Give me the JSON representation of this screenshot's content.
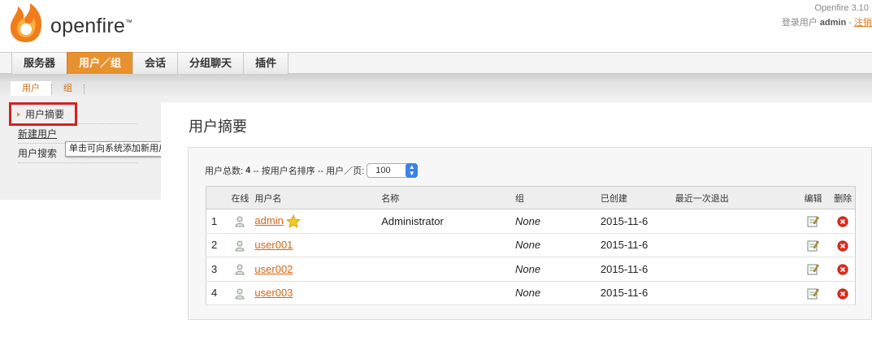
{
  "header": {
    "logo_text": "openfire",
    "logo_tm": "™",
    "version": "Openfire 3.10",
    "login_prefix": "登录用户",
    "login_user": "admin",
    "login_sep": "-",
    "logout_label": "注销"
  },
  "main_tabs": [
    {
      "label": "服务器",
      "active": false
    },
    {
      "label": "用户／组",
      "active": true
    },
    {
      "label": "会话",
      "active": false
    },
    {
      "label": "分组聊天",
      "active": false
    },
    {
      "label": "插件",
      "active": false
    }
  ],
  "sub_tabs": [
    {
      "label": "用户",
      "active": true
    },
    {
      "label": "组",
      "active": false
    }
  ],
  "sidebar": {
    "items": [
      {
        "label": "用户摘要",
        "current": true
      },
      {
        "label": "新建用户",
        "current": false
      },
      {
        "label": "用户搜索",
        "current": false
      }
    ],
    "tooltip": "单击可向系统添加新用户"
  },
  "main": {
    "title": "用户摘要",
    "summary_prefix": "用户总数:",
    "user_count": "4",
    "summary_middle": "-- 按用户名排序 -- 用户／页:",
    "per_page": "100"
  },
  "table": {
    "headers": {
      "num": "",
      "online": "在线",
      "username": "用户名",
      "name": "名称",
      "group": "组",
      "created": "已创建",
      "last_logout": "最近一次退出",
      "edit": "编辑",
      "delete": "删除"
    },
    "rows": [
      {
        "num": "1",
        "username": "admin",
        "name": "Administrator",
        "group": "None",
        "created": "2015-11-6",
        "last_logout": "",
        "admin_star": true
      },
      {
        "num": "2",
        "username": "user001",
        "name": "",
        "group": "None",
        "created": "2015-11-6",
        "last_logout": "",
        "admin_star": false
      },
      {
        "num": "3",
        "username": "user002",
        "name": "",
        "group": "None",
        "created": "2015-11-6",
        "last_logout": "",
        "admin_star": false
      },
      {
        "num": "4",
        "username": "user003",
        "name": "",
        "group": "None",
        "created": "2015-11-6",
        "last_logout": "",
        "admin_star": false
      }
    ]
  },
  "colors": {
    "accent": "#e8922f",
    "link": "#d8630e",
    "highlight": "#d52020",
    "select_button": "#3b82e8"
  },
  "icons": {
    "logo": "openfire-flame-icon",
    "online": "user-offline-icon",
    "admin": "star-icon",
    "edit": "edit-icon",
    "delete": "delete-icon",
    "select": "updown-chevron-icon"
  }
}
